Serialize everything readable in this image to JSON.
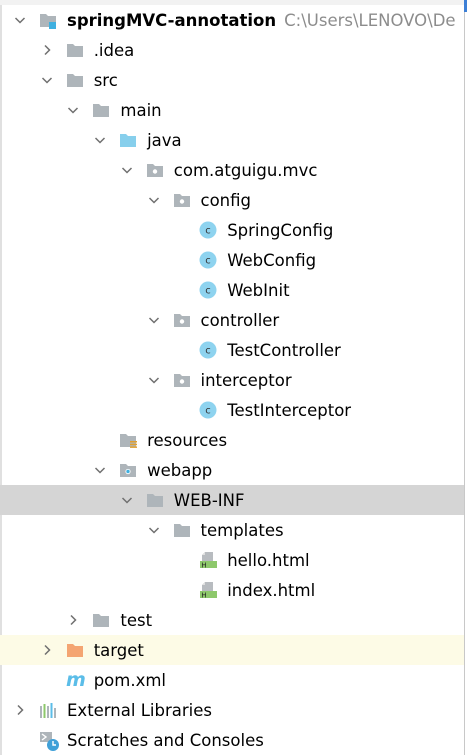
{
  "colors": {
    "folder": "#aeb5ba",
    "source_folder": "#87cfec",
    "excluded_folder": "#f4a572",
    "class_icon": "#8ed3ef",
    "html_icon": "#8dc86b",
    "selected_row": "#d5d5d5",
    "highlight_row": "#fdfbe6"
  },
  "tree": [
    {
      "level": 0,
      "chevron": "open",
      "icon": "module-folder-icon",
      "label": "springMVC-annotation",
      "bold": true,
      "path": "C:\\Users\\LENOVO\\De"
    },
    {
      "level": 1,
      "chevron": "closed",
      "icon": "folder-icon",
      "label": ".idea"
    },
    {
      "level": 1,
      "chevron": "open",
      "icon": "folder-icon",
      "label": "src"
    },
    {
      "level": 2,
      "chevron": "open",
      "icon": "folder-icon",
      "label": "main"
    },
    {
      "level": 3,
      "chevron": "open",
      "icon": "source-folder-icon",
      "label": "java"
    },
    {
      "level": 4,
      "chevron": "open",
      "icon": "package-icon",
      "label": "com.atguigu.mvc"
    },
    {
      "level": 5,
      "chevron": "open",
      "icon": "package-icon",
      "label": "config"
    },
    {
      "level": 6,
      "chevron": "none",
      "icon": "class-icon",
      "label": "SpringConfig"
    },
    {
      "level": 6,
      "chevron": "none",
      "icon": "class-icon",
      "label": "WebConfig"
    },
    {
      "level": 6,
      "chevron": "none",
      "icon": "class-icon",
      "label": "WebInit"
    },
    {
      "level": 5,
      "chevron": "open",
      "icon": "package-icon",
      "label": "controller"
    },
    {
      "level": 6,
      "chevron": "none",
      "icon": "class-icon",
      "label": "TestController"
    },
    {
      "level": 5,
      "chevron": "open",
      "icon": "package-icon",
      "label": "interceptor"
    },
    {
      "level": 6,
      "chevron": "none",
      "icon": "class-icon",
      "label": "TestInterceptor"
    },
    {
      "level": 3,
      "chevron": "none",
      "icon": "resources-folder-icon",
      "label": "resources"
    },
    {
      "level": 3,
      "chevron": "open",
      "icon": "web-folder-icon",
      "label": "webapp"
    },
    {
      "level": 4,
      "chevron": "open",
      "icon": "folder-icon",
      "label": "WEB-INF",
      "selected": true
    },
    {
      "level": 5,
      "chevron": "open",
      "icon": "folder-icon",
      "label": "templates"
    },
    {
      "level": 6,
      "chevron": "none",
      "icon": "html-file-icon",
      "label": "hello.html"
    },
    {
      "level": 6,
      "chevron": "none",
      "icon": "html-file-icon",
      "label": "index.html"
    },
    {
      "level": 2,
      "chevron": "closed",
      "icon": "folder-icon",
      "label": "test"
    },
    {
      "level": 1,
      "chevron": "closed",
      "icon": "excluded-folder-icon",
      "label": "target",
      "highlighted": true
    },
    {
      "level": 1,
      "chevron": "none",
      "icon": "maven-icon",
      "label": "pom.xml"
    },
    {
      "level": 0,
      "chevron": "closed",
      "icon": "libraries-icon",
      "label": "External Libraries"
    },
    {
      "level": 0,
      "chevron": "none",
      "icon": "scratches-icon",
      "label": "Scratches and Consoles"
    }
  ]
}
